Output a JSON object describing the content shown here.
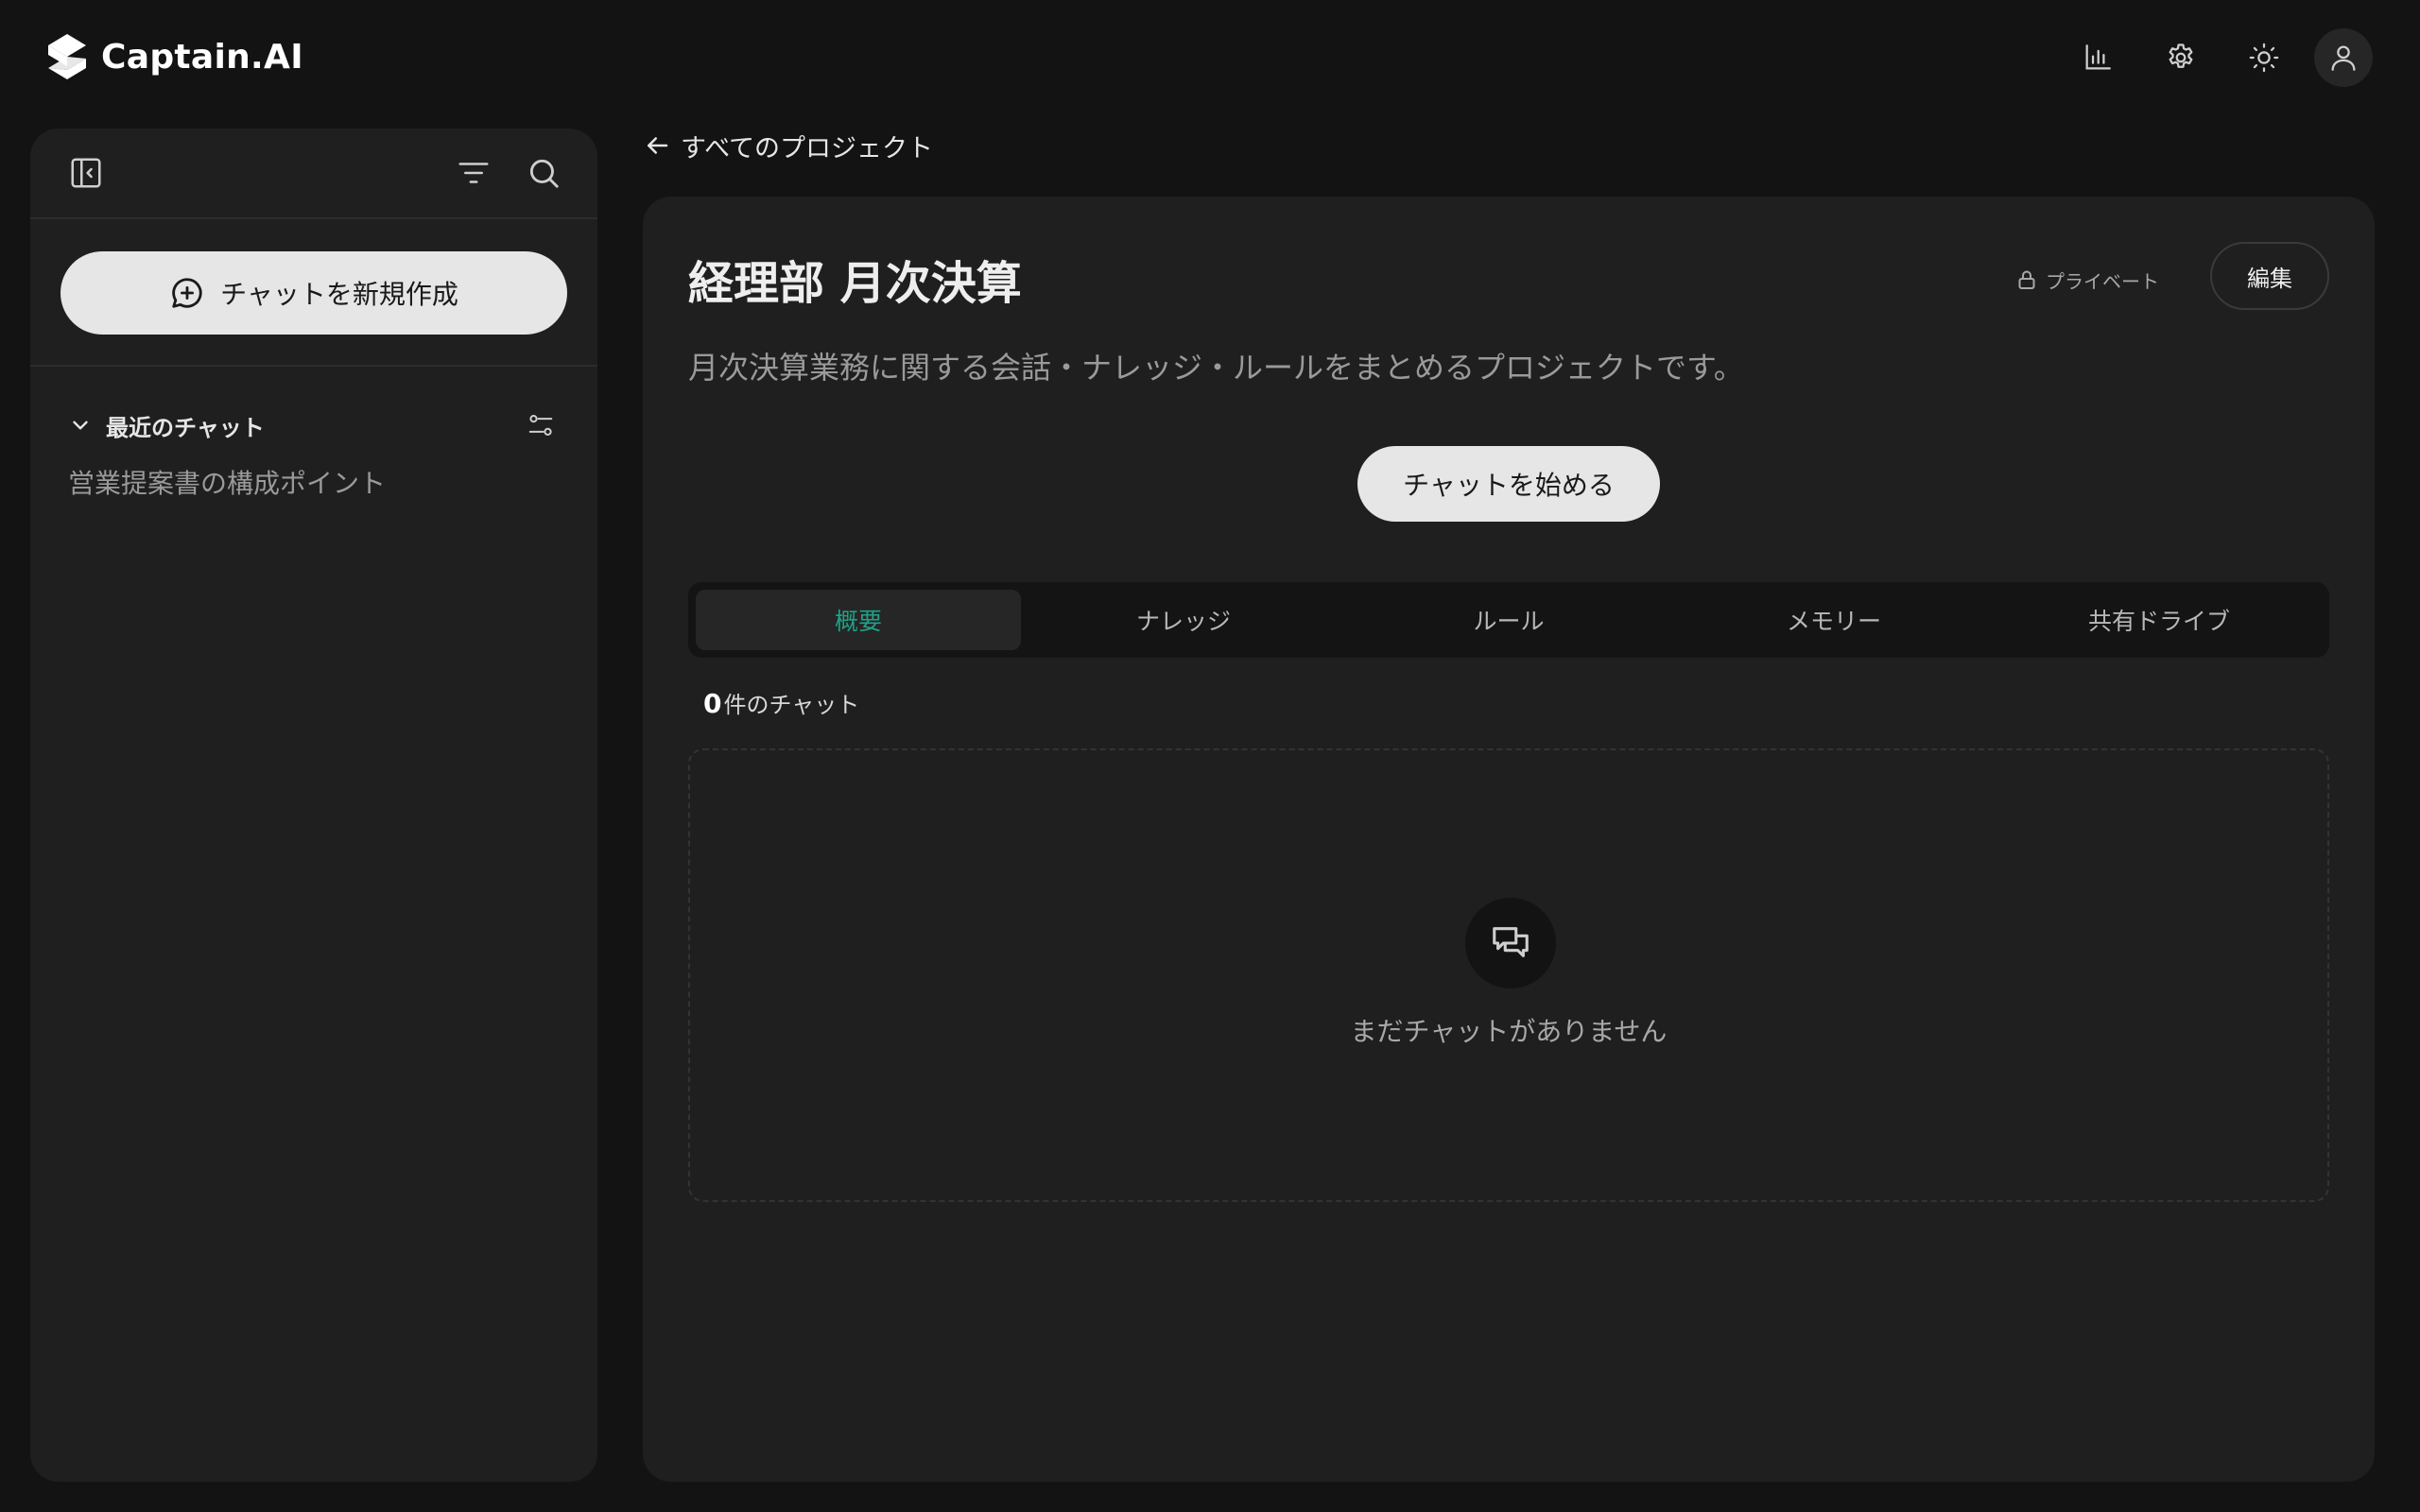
{
  "app": {
    "brand_name": "Captain.AI",
    "logo_icon": "captain-ai-logo",
    "accent_color": "#1fa287"
  },
  "topbar": {
    "icons": [
      "bar-chart-icon",
      "gear-icon",
      "sun-icon",
      "user-icon"
    ]
  },
  "sidebar": {
    "collapse_icon": "sidebar-collapse-icon",
    "filter_icon": "filter-icon",
    "search_icon": "search-icon",
    "new_chat_label": "チャットを新規作成",
    "new_chat_icon": "message-plus-icon",
    "recent_section": {
      "title": "最近のチャット",
      "settings_icon": "sliders-icon",
      "items": [
        {
          "label": "営業提案書の構成ポイント"
        }
      ]
    }
  },
  "breadcrumb": {
    "back_label": "すべてのプロジェクト",
    "back_icon": "arrow-left-icon"
  },
  "project": {
    "title": "経理部 月次決算",
    "visibility": "プライベート",
    "visibility_icon": "lock-icon",
    "edit_label": "編集",
    "description": "月次決算業務に関する会話・ナレッジ・ルールをまとめるプロジェクトです。",
    "start_chat_label": "チャットを始める"
  },
  "tabs": [
    {
      "label": "概要",
      "active": true
    },
    {
      "label": "ナレッジ",
      "active": false
    },
    {
      "label": "ルール",
      "active": false
    },
    {
      "label": "メモリー",
      "active": false
    },
    {
      "label": "共有ドライブ",
      "active": false
    }
  ],
  "chat_list": {
    "count": "0",
    "count_suffix": "件のチャット",
    "empty_icon": "chat-bubbles-icon",
    "empty_message": "まだチャットがありません"
  }
}
